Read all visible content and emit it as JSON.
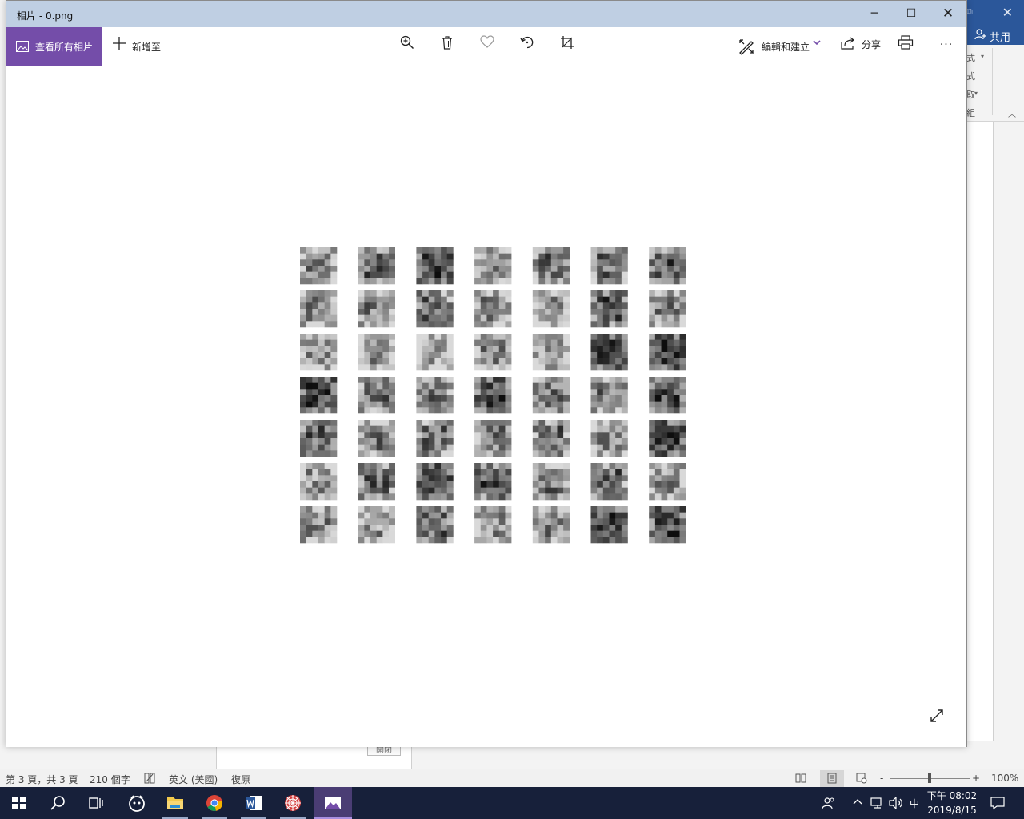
{
  "photos_window": {
    "title": "相片 - 0.png",
    "controls": {
      "minimize": "─",
      "maximize": "☐",
      "close": "✕"
    },
    "toolbar": {
      "view_all_label": "查看所有相片",
      "add_to_label": "新增至",
      "edit_create_label": "編輯和建立",
      "share_label": "分享",
      "more_label": "..."
    },
    "accent_color": "#744da9",
    "image": {
      "description_grid": {
        "rows": 7,
        "columns": 7,
        "content": "grayscale noise patches"
      }
    }
  },
  "word_background": {
    "share_label": "共用",
    "ribbon_fragments": [
      "式",
      "式",
      "取",
      "組"
    ],
    "dialog_fragment": "關閉",
    "status_bar": {
      "page": "第 3 頁，共 3 頁",
      "words": "210 個字",
      "language": "英文 (美國)",
      "mode": "復原",
      "zoom_minus": "-",
      "zoom_plus": "+",
      "zoom": "100%"
    },
    "title_color": "#2b579a"
  },
  "taskbar": {
    "apps": [
      "start",
      "search",
      "task-view",
      "media-player",
      "file-explorer",
      "chrome",
      "word",
      "spider-app",
      "photos"
    ],
    "ime": "中",
    "time": "下午 08:02",
    "date": "2019/8/15"
  }
}
